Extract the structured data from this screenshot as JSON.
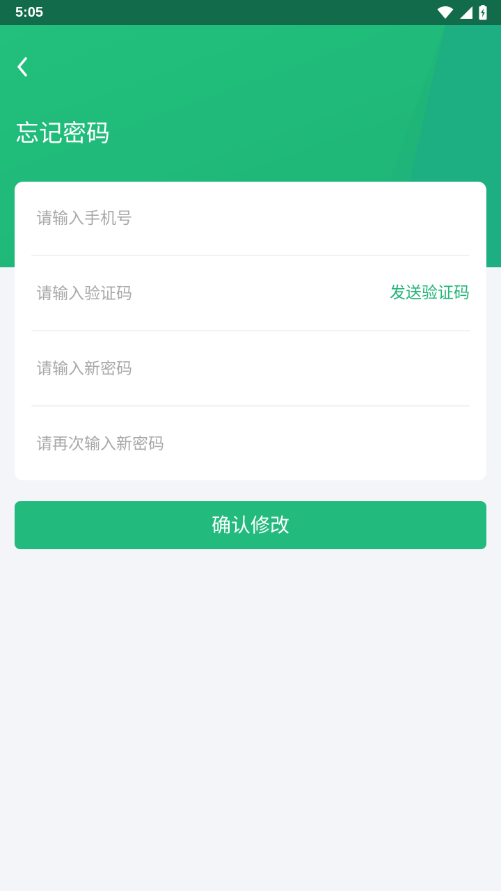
{
  "status_bar": {
    "time": "5:05",
    "icons": [
      "wifi-icon",
      "signal-icon",
      "battery-charging-icon"
    ]
  },
  "header": {
    "back_icon": "chevron-left-icon",
    "title": "忘记密码"
  },
  "form": {
    "phone": {
      "placeholder": "请输入手机号",
      "value": ""
    },
    "code": {
      "placeholder": "请输入验证码",
      "value": "",
      "send_label": "发送验证码"
    },
    "new_password": {
      "placeholder": "请输入新密码",
      "value": ""
    },
    "confirm_password": {
      "placeholder": "请再次输入新密码",
      "value": ""
    }
  },
  "confirm_button": {
    "label": "确认修改"
  },
  "colors": {
    "brand": "#22bb7d",
    "status_bar": "#126b4a",
    "page_background": "#f3f5f9",
    "placeholder": "#a9a9a9"
  }
}
